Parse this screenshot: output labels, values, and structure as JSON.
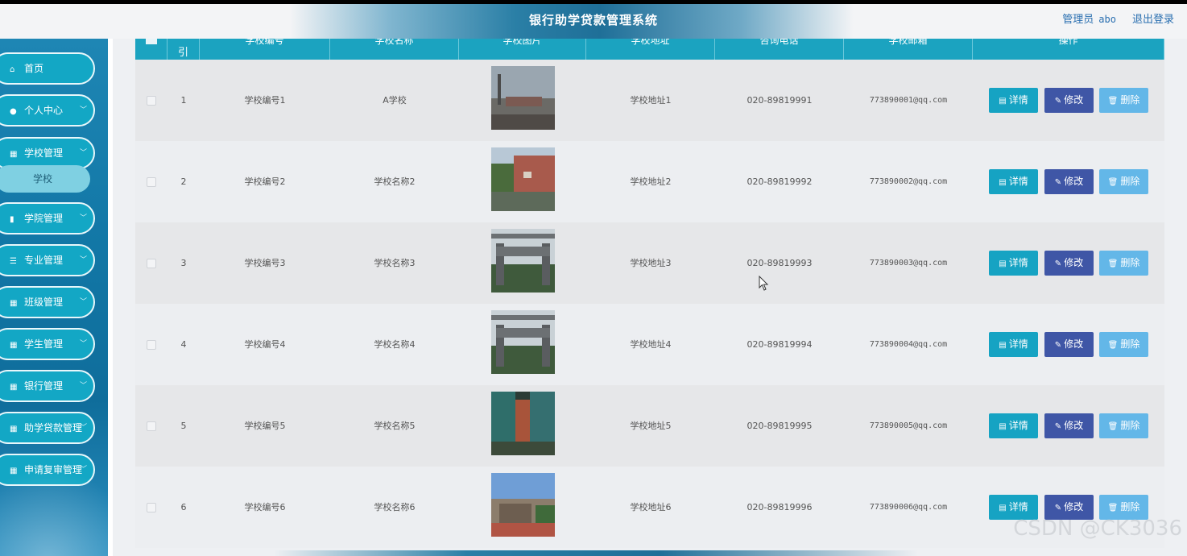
{
  "header": {
    "title": "银行助学贷款管理系统",
    "role": "管理员",
    "username": "abo",
    "logout": "退出登录"
  },
  "sidebar": {
    "items": [
      {
        "label": "首页",
        "icon": "home-icon",
        "glyph": "⌂",
        "has_children": false
      },
      {
        "label": "个人中心",
        "icon": "user-icon",
        "glyph": "●",
        "has_children": true
      },
      {
        "label": "学校管理",
        "icon": "grid-icon",
        "glyph": "▦",
        "has_children": true
      },
      {
        "label": "学院管理",
        "icon": "book-icon",
        "glyph": "▮",
        "has_children": true
      },
      {
        "label": "专业管理",
        "icon": "sliders-icon",
        "glyph": "☰",
        "has_children": true
      },
      {
        "label": "班级管理",
        "icon": "grid-icon",
        "glyph": "▦",
        "has_children": true
      },
      {
        "label": "学生管理",
        "icon": "grid-icon",
        "glyph": "▦",
        "has_children": true
      },
      {
        "label": "银行管理",
        "icon": "grid-icon",
        "glyph": "▦",
        "has_children": true
      },
      {
        "label": "助学贷款管理",
        "icon": "grid-icon",
        "glyph": "▦",
        "has_children": true
      },
      {
        "label": "申请复审管理",
        "icon": "grid-icon",
        "glyph": "▦",
        "has_children": true
      }
    ],
    "active_submenu": "学校"
  },
  "table": {
    "columns": [
      "",
      "引",
      "学校编号",
      "学校名称",
      "学校图片",
      "学校地址",
      "咨询电话",
      "学校邮箱",
      "操作"
    ],
    "rows": [
      {
        "index": "1",
        "code": "学校编号1",
        "name": "A学校",
        "address": "学校地址1",
        "phone": "020-89819991",
        "email": "773890001@qq.com"
      },
      {
        "index": "2",
        "code": "学校编号2",
        "name": "学校名称2",
        "address": "学校地址2",
        "phone": "020-89819992",
        "email": "773890002@qq.com"
      },
      {
        "index": "3",
        "code": "学校编号3",
        "name": "学校名称3",
        "address": "学校地址3",
        "phone": "020-89819993",
        "email": "773890003@qq.com"
      },
      {
        "index": "4",
        "code": "学校编号4",
        "name": "学校名称4",
        "address": "学校地址4",
        "phone": "020-89819994",
        "email": "773890004@qq.com"
      },
      {
        "index": "5",
        "code": "学校编号5",
        "name": "学校名称5",
        "address": "学校地址5",
        "phone": "020-89819995",
        "email": "773890005@qq.com"
      },
      {
        "index": "6",
        "code": "学校编号6",
        "name": "学校名称6",
        "address": "学校地址6",
        "phone": "020-89819996",
        "email": "773890006@qq.com"
      }
    ],
    "actions": {
      "detail": "详情",
      "edit": "修改",
      "delete": "删除"
    }
  },
  "watermark": "CSDN @CK3036",
  "colors": {
    "accent": "#16a3c3",
    "edit": "#3f56a6",
    "delete": "#63b7e8",
    "sidebar": "#1277a6"
  }
}
